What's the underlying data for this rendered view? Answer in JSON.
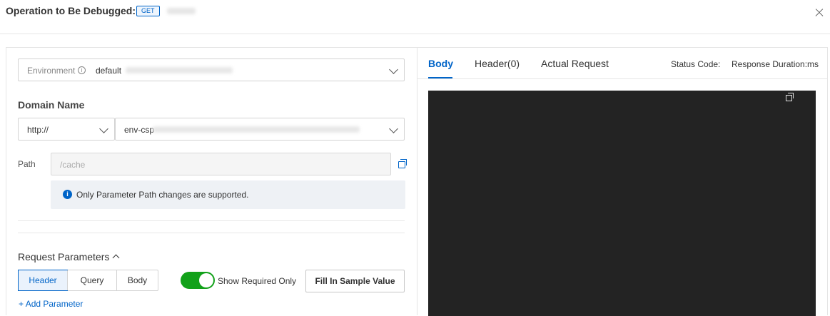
{
  "header": {
    "title": "Operation to Be Debugged:",
    "method": "GET"
  },
  "environment": {
    "label": "Environment",
    "value": "default"
  },
  "domain": {
    "label": "Domain Name",
    "protocol": "http://",
    "host_prefix": "env-csp"
  },
  "path": {
    "label": "Path",
    "placeholder": "/cache"
  },
  "notice": {
    "text": "Only Parameter Path changes are supported."
  },
  "request_params": {
    "label": "Request Parameters",
    "tabs": [
      "Header",
      "Query",
      "Body"
    ],
    "active_tab": "Header",
    "toggle_label": "Show Required Only",
    "toggle_on": true,
    "fill_button": "Fill In Sample Value",
    "add_label": "Add Parameter"
  },
  "response": {
    "tabs": [
      "Body",
      "Header(0)",
      "Actual Request"
    ],
    "active_tab": "Body",
    "status_code_label": "Status Code:",
    "duration_label": "Response Duration:ms"
  },
  "colors": {
    "accent": "#0064c8",
    "toggle_on": "#12a11a",
    "code_bg": "#232323"
  }
}
